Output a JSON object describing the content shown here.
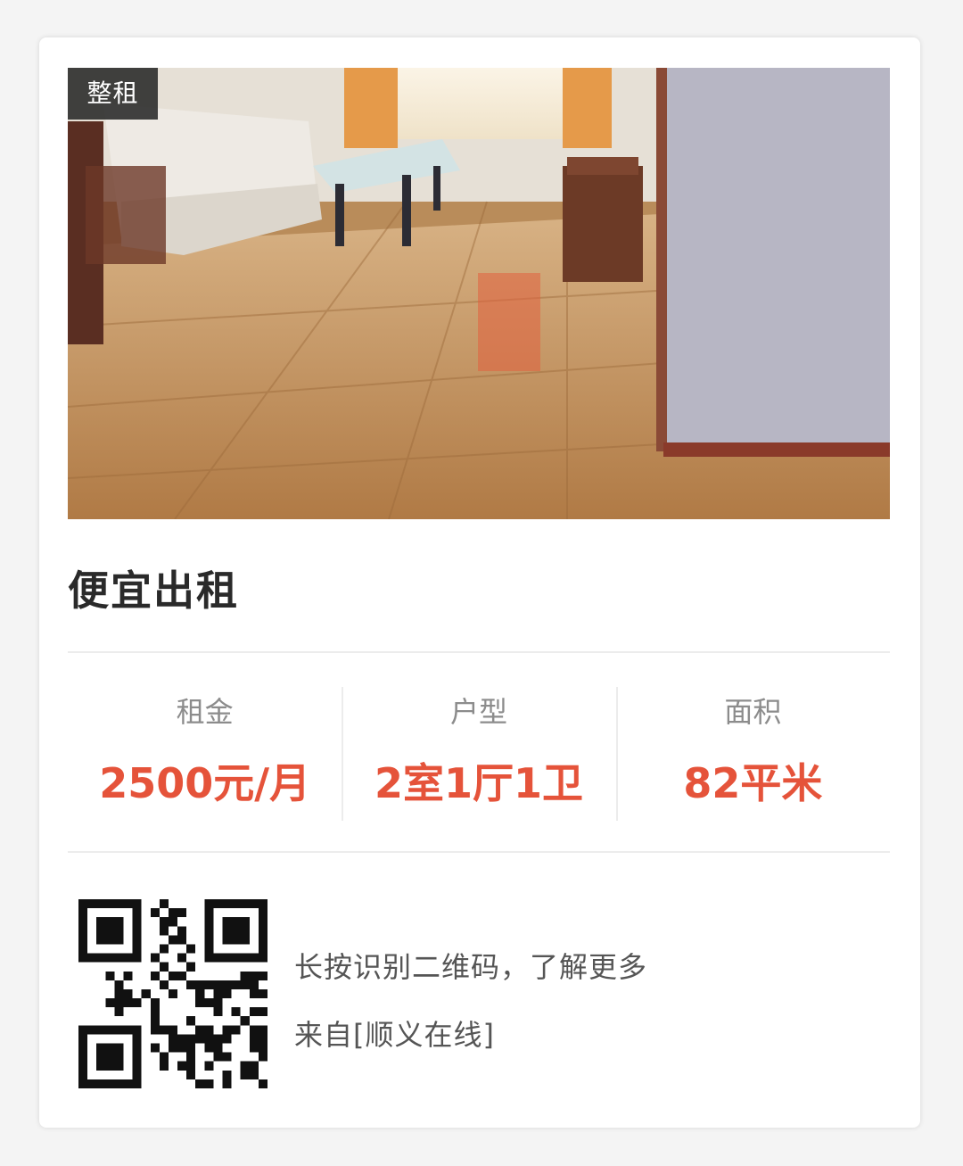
{
  "listing": {
    "badge": "整租",
    "title": "便宜出租",
    "photo_alt": "living-room-photo"
  },
  "stats": [
    {
      "label": "租金",
      "value": "2500元/月"
    },
    {
      "label": "户型",
      "value": "2室1厅1卫"
    },
    {
      "label": "面积",
      "value": "82平米"
    }
  ],
  "footer": {
    "qr_icon": "qr-code-icon",
    "prompt": "长按识别二维码，了解更多",
    "source": "来自[顺义在线]"
  },
  "colors": {
    "accent": "#e5533a",
    "label": "#8c8c8c",
    "title": "#2a2a2a",
    "badge_bg": "#282828"
  }
}
